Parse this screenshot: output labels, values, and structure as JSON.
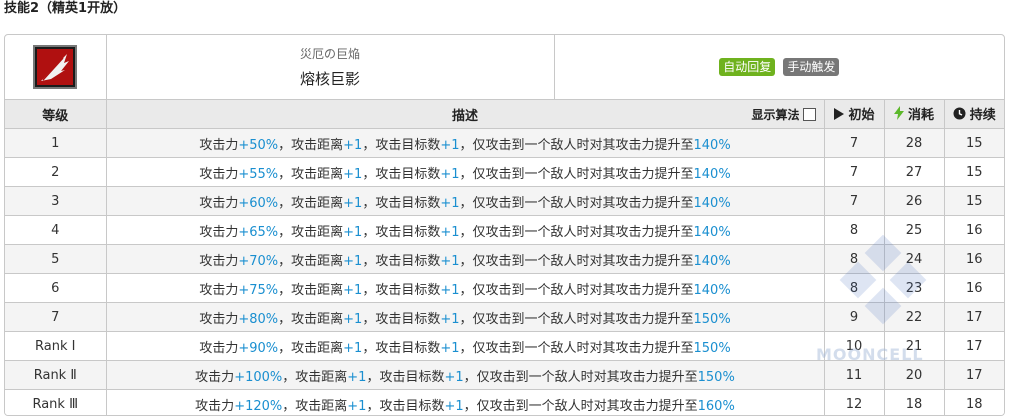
{
  "section_title": "技能2（精英1开放）",
  "skill": {
    "icon": "flame-feather-icon",
    "subtitle": "災厄の巨焔",
    "name": "熔核巨影",
    "tags": [
      "自动回复",
      "手动触发"
    ]
  },
  "table": {
    "headers": {
      "level": "等级",
      "description": "描述",
      "show_formula": "显示算法",
      "initial": "初始",
      "cost": "消耗",
      "duration": "持续"
    },
    "rows": [
      {
        "level": "1",
        "atk": "+50%",
        "range": "+1",
        "targets": "+1",
        "max": "140%",
        "initial": "7",
        "cost": "28",
        "duration": "15"
      },
      {
        "level": "2",
        "atk": "+55%",
        "range": "+1",
        "targets": "+1",
        "max": "140%",
        "initial": "7",
        "cost": "27",
        "duration": "15"
      },
      {
        "level": "3",
        "atk": "+60%",
        "range": "+1",
        "targets": "+1",
        "max": "140%",
        "initial": "7",
        "cost": "26",
        "duration": "15"
      },
      {
        "level": "4",
        "atk": "+65%",
        "range": "+1",
        "targets": "+1",
        "max": "140%",
        "initial": "8",
        "cost": "25",
        "duration": "16"
      },
      {
        "level": "5",
        "atk": "+70%",
        "range": "+1",
        "targets": "+1",
        "max": "140%",
        "initial": "8",
        "cost": "24",
        "duration": "16"
      },
      {
        "level": "6",
        "atk": "+75%",
        "range": "+1",
        "targets": "+1",
        "max": "140%",
        "initial": "8",
        "cost": "23",
        "duration": "16"
      },
      {
        "level": "7",
        "atk": "+80%",
        "range": "+1",
        "targets": "+1",
        "max": "150%",
        "initial": "9",
        "cost": "22",
        "duration": "17"
      },
      {
        "level": "Rank Ⅰ",
        "atk": "+90%",
        "range": "+1",
        "targets": "+1",
        "max": "150%",
        "initial": "10",
        "cost": "21",
        "duration": "17"
      },
      {
        "level": "Rank Ⅱ",
        "atk": "+100%",
        "range": "+1",
        "targets": "+1",
        "max": "150%",
        "initial": "11",
        "cost": "20",
        "duration": "17"
      },
      {
        "level": "Rank Ⅲ",
        "atk": "+120%",
        "range": "+1",
        "targets": "+1",
        "max": "160%",
        "initial": "12",
        "cost": "18",
        "duration": "18"
      }
    ],
    "desc_parts": {
      "atk_label": "攻击力",
      "range_label": "，攻击距离",
      "targets_label": "，攻击目标数",
      "max_label": "，仅攻击到一个敌人时对其攻击力提升至"
    }
  },
  "watermark": "MOONCELL",
  "colors": {
    "highlight": "#1a8fd0",
    "tag_green": "#6fb21e",
    "tag_gray": "#777777",
    "header_bg": "#eaeaea"
  }
}
